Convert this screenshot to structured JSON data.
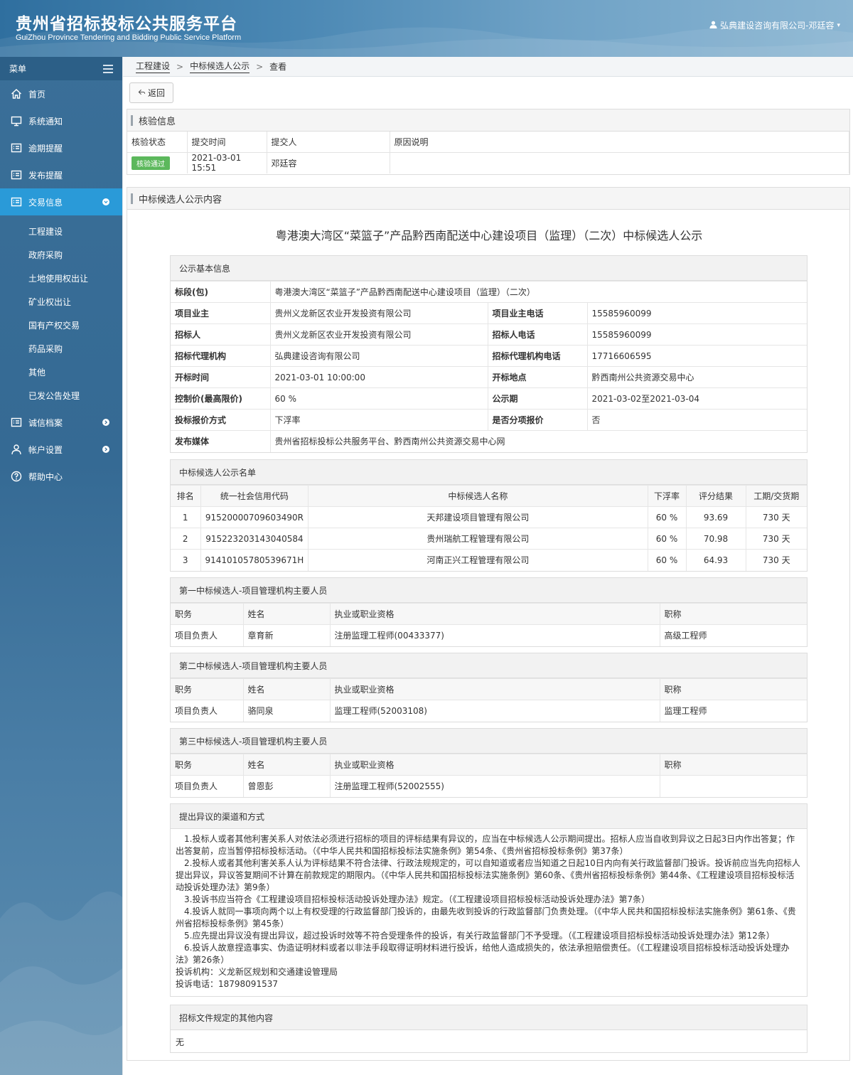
{
  "header": {
    "title": "贵州省招标投标公共服务平台",
    "subtitle": "GuiZhou Province Tendering and Bidding Public Service Platform",
    "user": "弘典建设咨询有限公司-邓廷容"
  },
  "sidebar": {
    "menu_label": "菜单",
    "items": [
      {
        "label": "首页",
        "icon": "home-icon"
      },
      {
        "label": "系统通知",
        "icon": "monitor-icon"
      },
      {
        "label": "逾期提醒",
        "icon": "list-icon"
      },
      {
        "label": "发布提醒",
        "icon": "list-icon"
      },
      {
        "label": "交易信息",
        "icon": "list-icon"
      },
      {
        "label": "诚信档案",
        "icon": "list-icon"
      },
      {
        "label": "帐户设置",
        "icon": "user-icon"
      },
      {
        "label": "帮助中心",
        "icon": "question-icon"
      }
    ],
    "subitems": [
      "工程建设",
      "政府采购",
      "土地使用权出让",
      "矿业权出让",
      "国有产权交易",
      "药品采购",
      "其他",
      "已发公告处理"
    ]
  },
  "breadcrumb": [
    "工程建设",
    "中标候选人公示",
    "查看"
  ],
  "back_label": "返回",
  "verify": {
    "title": "核验信息",
    "headers": [
      "核验状态",
      "提交时间",
      "提交人",
      "原因说明"
    ],
    "status": "核验通过",
    "time": "2021-03-01 15:51",
    "submitter": "邓廷容",
    "reason": ""
  },
  "content": {
    "panel_title": "中标候选人公示内容",
    "doc_title": "粤港澳大湾区“菜篮子”产品黔西南配送中心建设项目（监理）（二次）中标候选人公示",
    "basic": {
      "title": "公示基本信息",
      "section_label": "标段(包)",
      "section_value": "粤港澳大湾区“菜篮子”产品黔西南配送中心建设项目（监理）（二次）",
      "rows": [
        [
          "项目业主",
          "贵州义龙新区农业开发投资有限公司",
          "项目业主电话",
          "15585960099"
        ],
        [
          "招标人",
          "贵州义龙新区农业开发投资有限公司",
          "招标人电话",
          "15585960099"
        ],
        [
          "招标代理机构",
          "弘典建设咨询有限公司",
          "招标代理机构电话",
          "17716606595"
        ],
        [
          "开标时间",
          "2021-03-01 10:00:00",
          "开标地点",
          "黔西南州公共资源交易中心"
        ],
        [
          "控制价(最高限价)",
          "60 %",
          "公示期",
          "2021-03-02至2021-03-04"
        ],
        [
          "投标报价方式",
          "下浮率",
          "是否分项报价",
          "否"
        ]
      ],
      "media_label": "发布媒体",
      "media_value": "贵州省招标投标公共服务平台、黔西南州公共资源交易中心网"
    },
    "candidates": {
      "title": "中标候选人公示名单",
      "headers": [
        "排名",
        "统一社会信用代码",
        "中标候选人名称",
        "下浮率",
        "评分结果",
        "工期/交货期"
      ],
      "rows": [
        [
          "1",
          "91520000709603490R",
          "天邦建设项目管理有限公司",
          "60 %",
          "93.69",
          "730 天"
        ],
        [
          "2",
          "915223203143040584",
          "贵州瑞航工程管理有限公司",
          "60 %",
          "70.98",
          "730 天"
        ],
        [
          "3",
          "91410105780539671H",
          "河南正兴工程管理有限公司",
          "60 %",
          "64.93",
          "730 天"
        ]
      ]
    },
    "staff": [
      {
        "title": "第一中标候选人-项目管理机构主要人员",
        "headers": [
          "职务",
          "姓名",
          "执业或职业资格",
          "职称"
        ],
        "row": [
          "项目负责人",
          "章育新",
          "注册监理工程师(00433377)",
          "高级工程师"
        ]
      },
      {
        "title": "第二中标候选人-项目管理机构主要人员",
        "headers": [
          "职务",
          "姓名",
          "执业或职业资格",
          "职称"
        ],
        "row": [
          "项目负责人",
          "骆同泉",
          "监理工程师(52003108)",
          "监理工程师"
        ]
      },
      {
        "title": "第三中标候选人-项目管理机构主要人员",
        "headers": [
          "职务",
          "姓名",
          "执业或职业资格",
          "职称"
        ],
        "row": [
          "项目负责人",
          "曾恩彭",
          "注册监理工程师(52002555)",
          ""
        ]
      }
    ],
    "objection": {
      "title": "提出异议的渠道和方式",
      "paragraphs": [
        "1.投标人或者其他利害关系人对依法必须进行招标的项目的评标结果有异议的，应当在中标候选人公示期间提出。招标人应当自收到异议之日起3日内作出答复；作出答复前，应当暂停招标投标活动。（《中华人民共和国招标投标法实施条例》第54条、《贵州省招标投标条例》第37条）",
        "2.投标人或者其他利害关系人认为评标结果不符合法律、行政法规规定的，可以自知道或者应当知道之日起10日内向有关行政监督部门投诉。投诉前应当先向招标人提出异议，异议答复期间不计算在前款规定的期限内。（《中华人民共和国招标投标法实施条例》第60条、《贵州省招标投标条例》第44条、《工程建设项目招标投标活动投诉处理办法》第9条）",
        "3.投诉书应当符合《工程建设项目招标投标活动投诉处理办法》规定。（《工程建设项目招标投标活动投诉处理办法》第7条）",
        "4.投诉人就同一事项向两个以上有权受理的行政监督部门投诉的，由最先收到投诉的行政监督部门负责处理。（《中华人民共和国招标投标法实施条例》第61条、《贵州省招标投标条例》第45条）",
        "5.应先提出异议没有提出异议，超过投诉时效等不符合受理条件的投诉，有关行政监督部门不予受理。（《工程建设项目招标投标活动投诉处理办法》第12条）",
        "6.投诉人故意捏造事实、伪造证明材料或者以非法手段取得证明材料进行投诉，给他人造成损失的，依法承担赔偿责任。（《工程建设项目招标投标活动投诉处理办法》第26条）"
      ],
      "agency": "投诉机构：义龙新区规划和交通建设管理局",
      "phone": "投诉电话：18798091537"
    },
    "other": {
      "title": "招标文件规定的其他内容",
      "value": "无"
    }
  },
  "colors": {
    "accent": "#2a9ad8",
    "success": "#5cb85c",
    "sidebar": "#356a94"
  }
}
